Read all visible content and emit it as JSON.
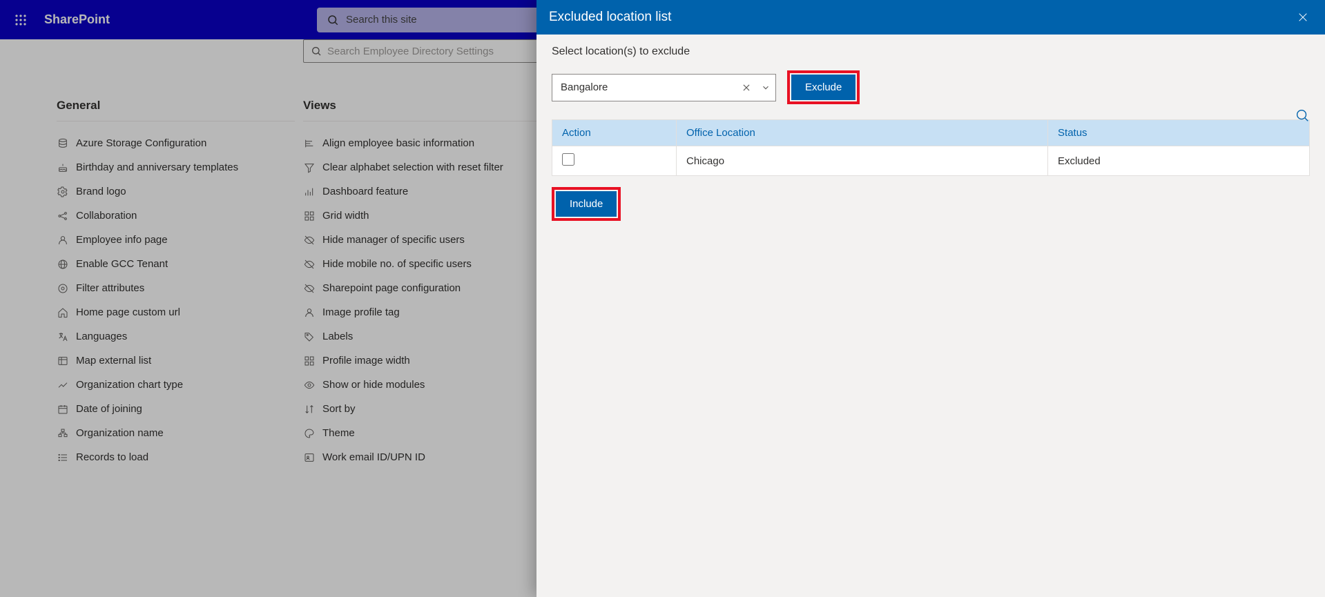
{
  "header": {
    "brand": "SharePoint",
    "searchPlaceholder": "Search this site"
  },
  "subsearch": {
    "placeholder": "Search Employee Directory Settings"
  },
  "columns": {
    "general": {
      "title": "General",
      "items": [
        "Azure Storage Configuration",
        "Birthday and anniversary templates",
        "Brand logo",
        "Collaboration",
        "Employee info page",
        "Enable GCC Tenant",
        "Filter attributes",
        "Home page custom url",
        "Languages",
        "Map external list",
        "Organization chart type",
        "Date of joining",
        "Organization name",
        "Records to load"
      ]
    },
    "views": {
      "title": "Views",
      "items": [
        "Align employee basic information",
        "Clear alphabet selection with reset filter",
        "Dashboard feature",
        "Grid width",
        "Hide manager of specific users",
        "Hide mobile no. of specific users",
        "Sharepoint page configuration",
        "Image profile tag",
        "Labels",
        "Profile image width",
        "Show or hide modules",
        "Sort by",
        "Theme",
        "Work email ID/UPN ID"
      ]
    }
  },
  "panel": {
    "title": "Excluded location list",
    "subtitle": "Select location(s) to exclude",
    "comboValue": "Bangalore",
    "excludeLabel": "Exclude",
    "includeLabel": "Include",
    "table": {
      "headers": {
        "action": "Action",
        "location": "Office Location",
        "status": "Status"
      },
      "rows": [
        {
          "location": "Chicago",
          "status": "Excluded"
        }
      ]
    }
  }
}
